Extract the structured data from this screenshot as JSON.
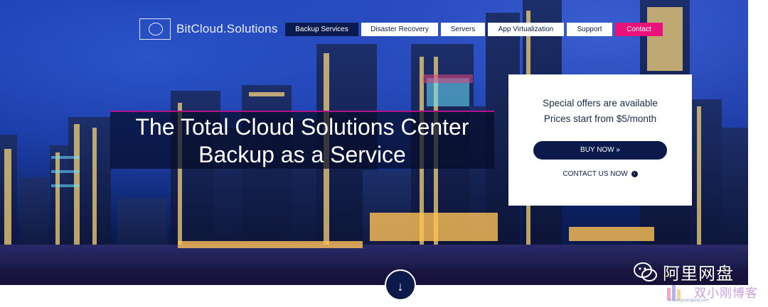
{
  "logo": {
    "text": "BitCloud.Solutions",
    "icon": "cloud-logo-icon"
  },
  "nav": [
    {
      "label": "Backup Services",
      "state": "active"
    },
    {
      "label": "Disaster Recovery",
      "state": "normal"
    },
    {
      "label": "Servers",
      "state": "normal"
    },
    {
      "label": "App Virtualization",
      "state": "normal"
    },
    {
      "label": "Support",
      "state": "normal"
    },
    {
      "label": "Contact",
      "state": "highlight"
    }
  ],
  "headline": {
    "line1": "The Total Cloud Solutions Center",
    "line2": "Backup as a Service"
  },
  "offer": {
    "line1": "Special offers are available",
    "line2": "Prices start from $5/month",
    "buy_label": "BUY NOW »",
    "contact_label": "CONTACT US NOW",
    "contact_icon": "chevron-circle-right-icon"
  },
  "scroll": {
    "icon": "arrow-down-icon",
    "glyph": "↓"
  },
  "watermark": {
    "primary_text": "阿里网盘",
    "primary_icon": "wechat-icon",
    "secondary_text": "双小刚博客",
    "secondary_url_text": "shuangxiaogang.com"
  },
  "colors": {
    "navy": "#0b1a4a",
    "accent_pink": "#e8127a",
    "sky_blue": "#1330a8"
  }
}
